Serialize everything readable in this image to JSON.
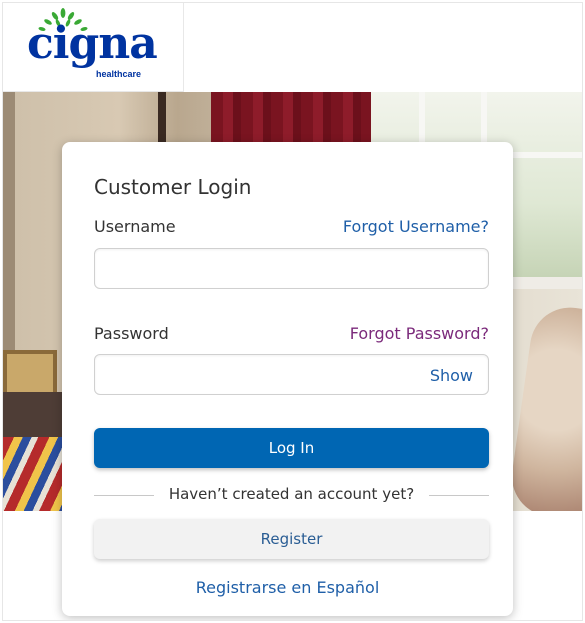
{
  "brand": {
    "name": "cigna",
    "tagline": "healthcare",
    "primary_color": "#0033a0",
    "leaf_color": "#3aa935"
  },
  "login": {
    "title": "Customer Login",
    "username_label": "Username",
    "forgot_username": "Forgot Username?",
    "username_value": "",
    "password_label": "Password",
    "forgot_password": "Forgot Password?",
    "password_value": "",
    "show_label": "Show",
    "login_button": "Log In",
    "no_account_text": "Haven’t created an account yet?",
    "register_button": "Register",
    "spanish_link": "Registrarse en Español"
  },
  "colors": {
    "link_blue": "#1f5fa8",
    "link_visited": "#7b2a7b",
    "button_blue": "#0066b3"
  }
}
